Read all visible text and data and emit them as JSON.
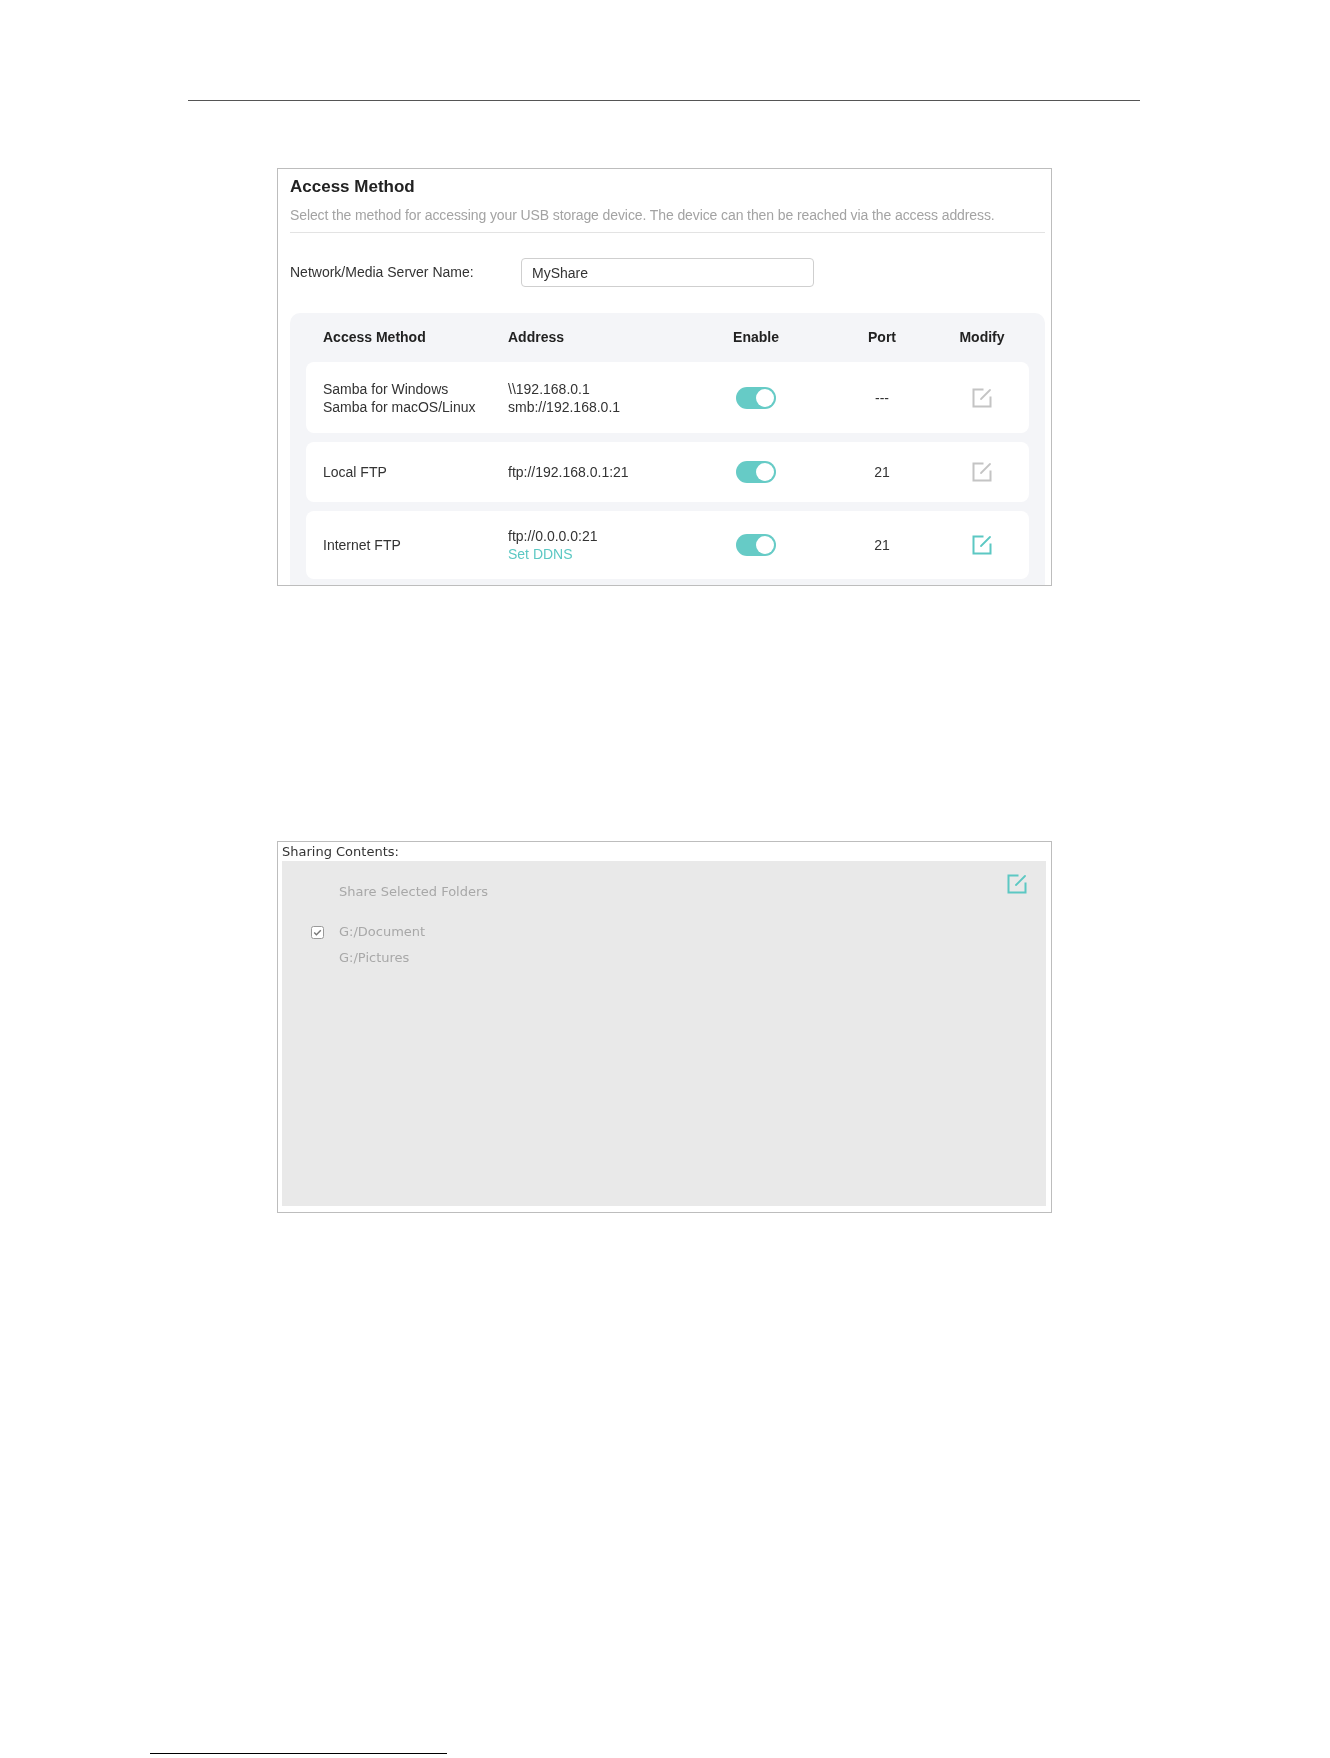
{
  "access_method_panel": {
    "title": "Access Method",
    "description": "Select the method for accessing your USB storage device. The device can then be reached via the access address.",
    "server_name": {
      "label": "Network/Media Server Name:",
      "value": "MyShare"
    },
    "table": {
      "columns": [
        "Access Method",
        "Address",
        "Enable",
        "Port",
        "Modify"
      ],
      "rows": [
        {
          "methods": [
            "Samba for Windows",
            "Samba for macOS/Linux"
          ],
          "addresses": [
            "\\\\192.168.0.1",
            "smb://192.168.0.1"
          ],
          "on": true,
          "port": "---",
          "modify_active": false
        },
        {
          "methods": [
            "Local FTP"
          ],
          "addresses": [
            "ftp://192.168.0.1:21"
          ],
          "on": true,
          "port": "21",
          "modify_active": false
        },
        {
          "methods": [
            "Internet FTP"
          ],
          "addresses": [
            "ftp://0.0.0.0:21"
          ],
          "link": "Set DDNS",
          "on": true,
          "port": "21",
          "modify_active": true
        }
      ]
    }
  },
  "sharing_panel": {
    "title": "Sharing Contents:",
    "heading": "Share Selected Folders",
    "folders": [
      {
        "path": "G:/Document",
        "checked": true
      },
      {
        "path": "G:/Pictures",
        "checked": false
      }
    ]
  }
}
